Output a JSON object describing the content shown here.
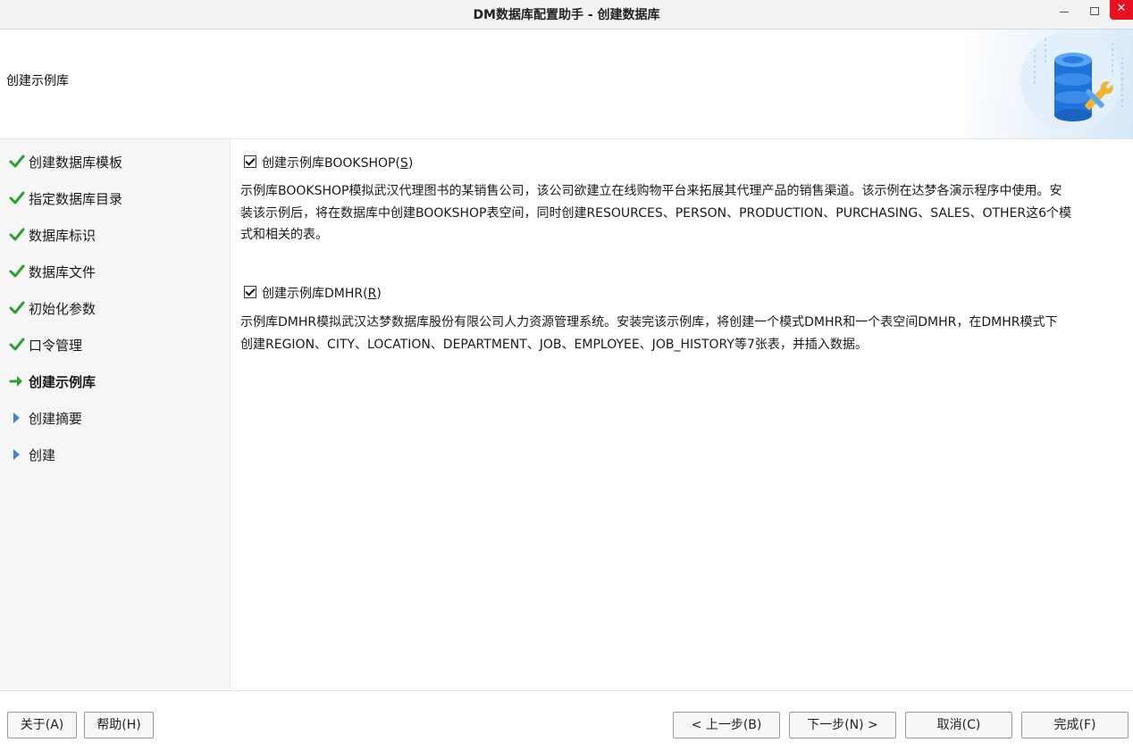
{
  "window": {
    "title": "DM数据库配置助手 - 创建数据库",
    "close_glyph": "✕"
  },
  "header": {
    "title": "创建示例库",
    "banner_icon": "database-wrench-icon"
  },
  "sidebar": {
    "items": [
      {
        "label": "创建数据库模板",
        "status": "done",
        "icon": "check-icon"
      },
      {
        "label": "指定数据库目录",
        "status": "done",
        "icon": "check-icon"
      },
      {
        "label": "数据库标识",
        "status": "done",
        "icon": "check-icon"
      },
      {
        "label": "数据库文件",
        "status": "done",
        "icon": "check-icon"
      },
      {
        "label": "初始化参数",
        "status": "done",
        "icon": "check-icon"
      },
      {
        "label": "口令管理",
        "status": "done",
        "icon": "check-icon"
      },
      {
        "label": "创建示例库",
        "status": "current",
        "icon": "arrow-right-icon"
      },
      {
        "label": "创建摘要",
        "status": "pending",
        "icon": "triangle-right-icon"
      },
      {
        "label": "创建",
        "status": "pending",
        "icon": "triangle-right-icon"
      }
    ],
    "colors": {
      "done": "#2e9e2e",
      "current": "#2e9e2e",
      "pending": "#3a86d4"
    }
  },
  "content": {
    "bookshop": {
      "label_prefix": "创建示例库BOOKSHOP(",
      "mnemonic": "S",
      "label_suffix": ")",
      "checked": true,
      "description_line1": "示例库BOOKSHOP模拟武汉代理图书的某销售公司，该公司欲建立在线购物平台来拓展其代理产品的销售渠道。该示例在达梦各演示程序中使用。安",
      "description_line2": "装该示例后，将在数据库中创建BOOKSHOP表空间，同时创建RESOURCES、PERSON、PRODUCTION、PURCHASING、SALES、OTHER这6个模",
      "description_line3": "式和相关的表。"
    },
    "dmhr": {
      "label_prefix": "创建示例库DMHR(",
      "mnemonic": "R",
      "label_suffix": ")",
      "checked": true,
      "description_line1": "示例库DMHR模拟武汉达梦数据库股份有限公司人力资源管理系统。安装完该示例库，将创建一个模式DMHR和一个表空间DMHR，在DMHR模式下",
      "description_line2": "创建REGION、CITY、LOCATION、DEPARTMENT、JOB、EMPLOYEE、JOB_HISTORY等7张表，并插入数据。"
    }
  },
  "footer": {
    "about": "关于(A)",
    "help": "帮助(H)",
    "prev": "< 上一步(B)",
    "next": "下一步(N) >",
    "cancel": "取消(C)",
    "finish": "完成(F)"
  }
}
